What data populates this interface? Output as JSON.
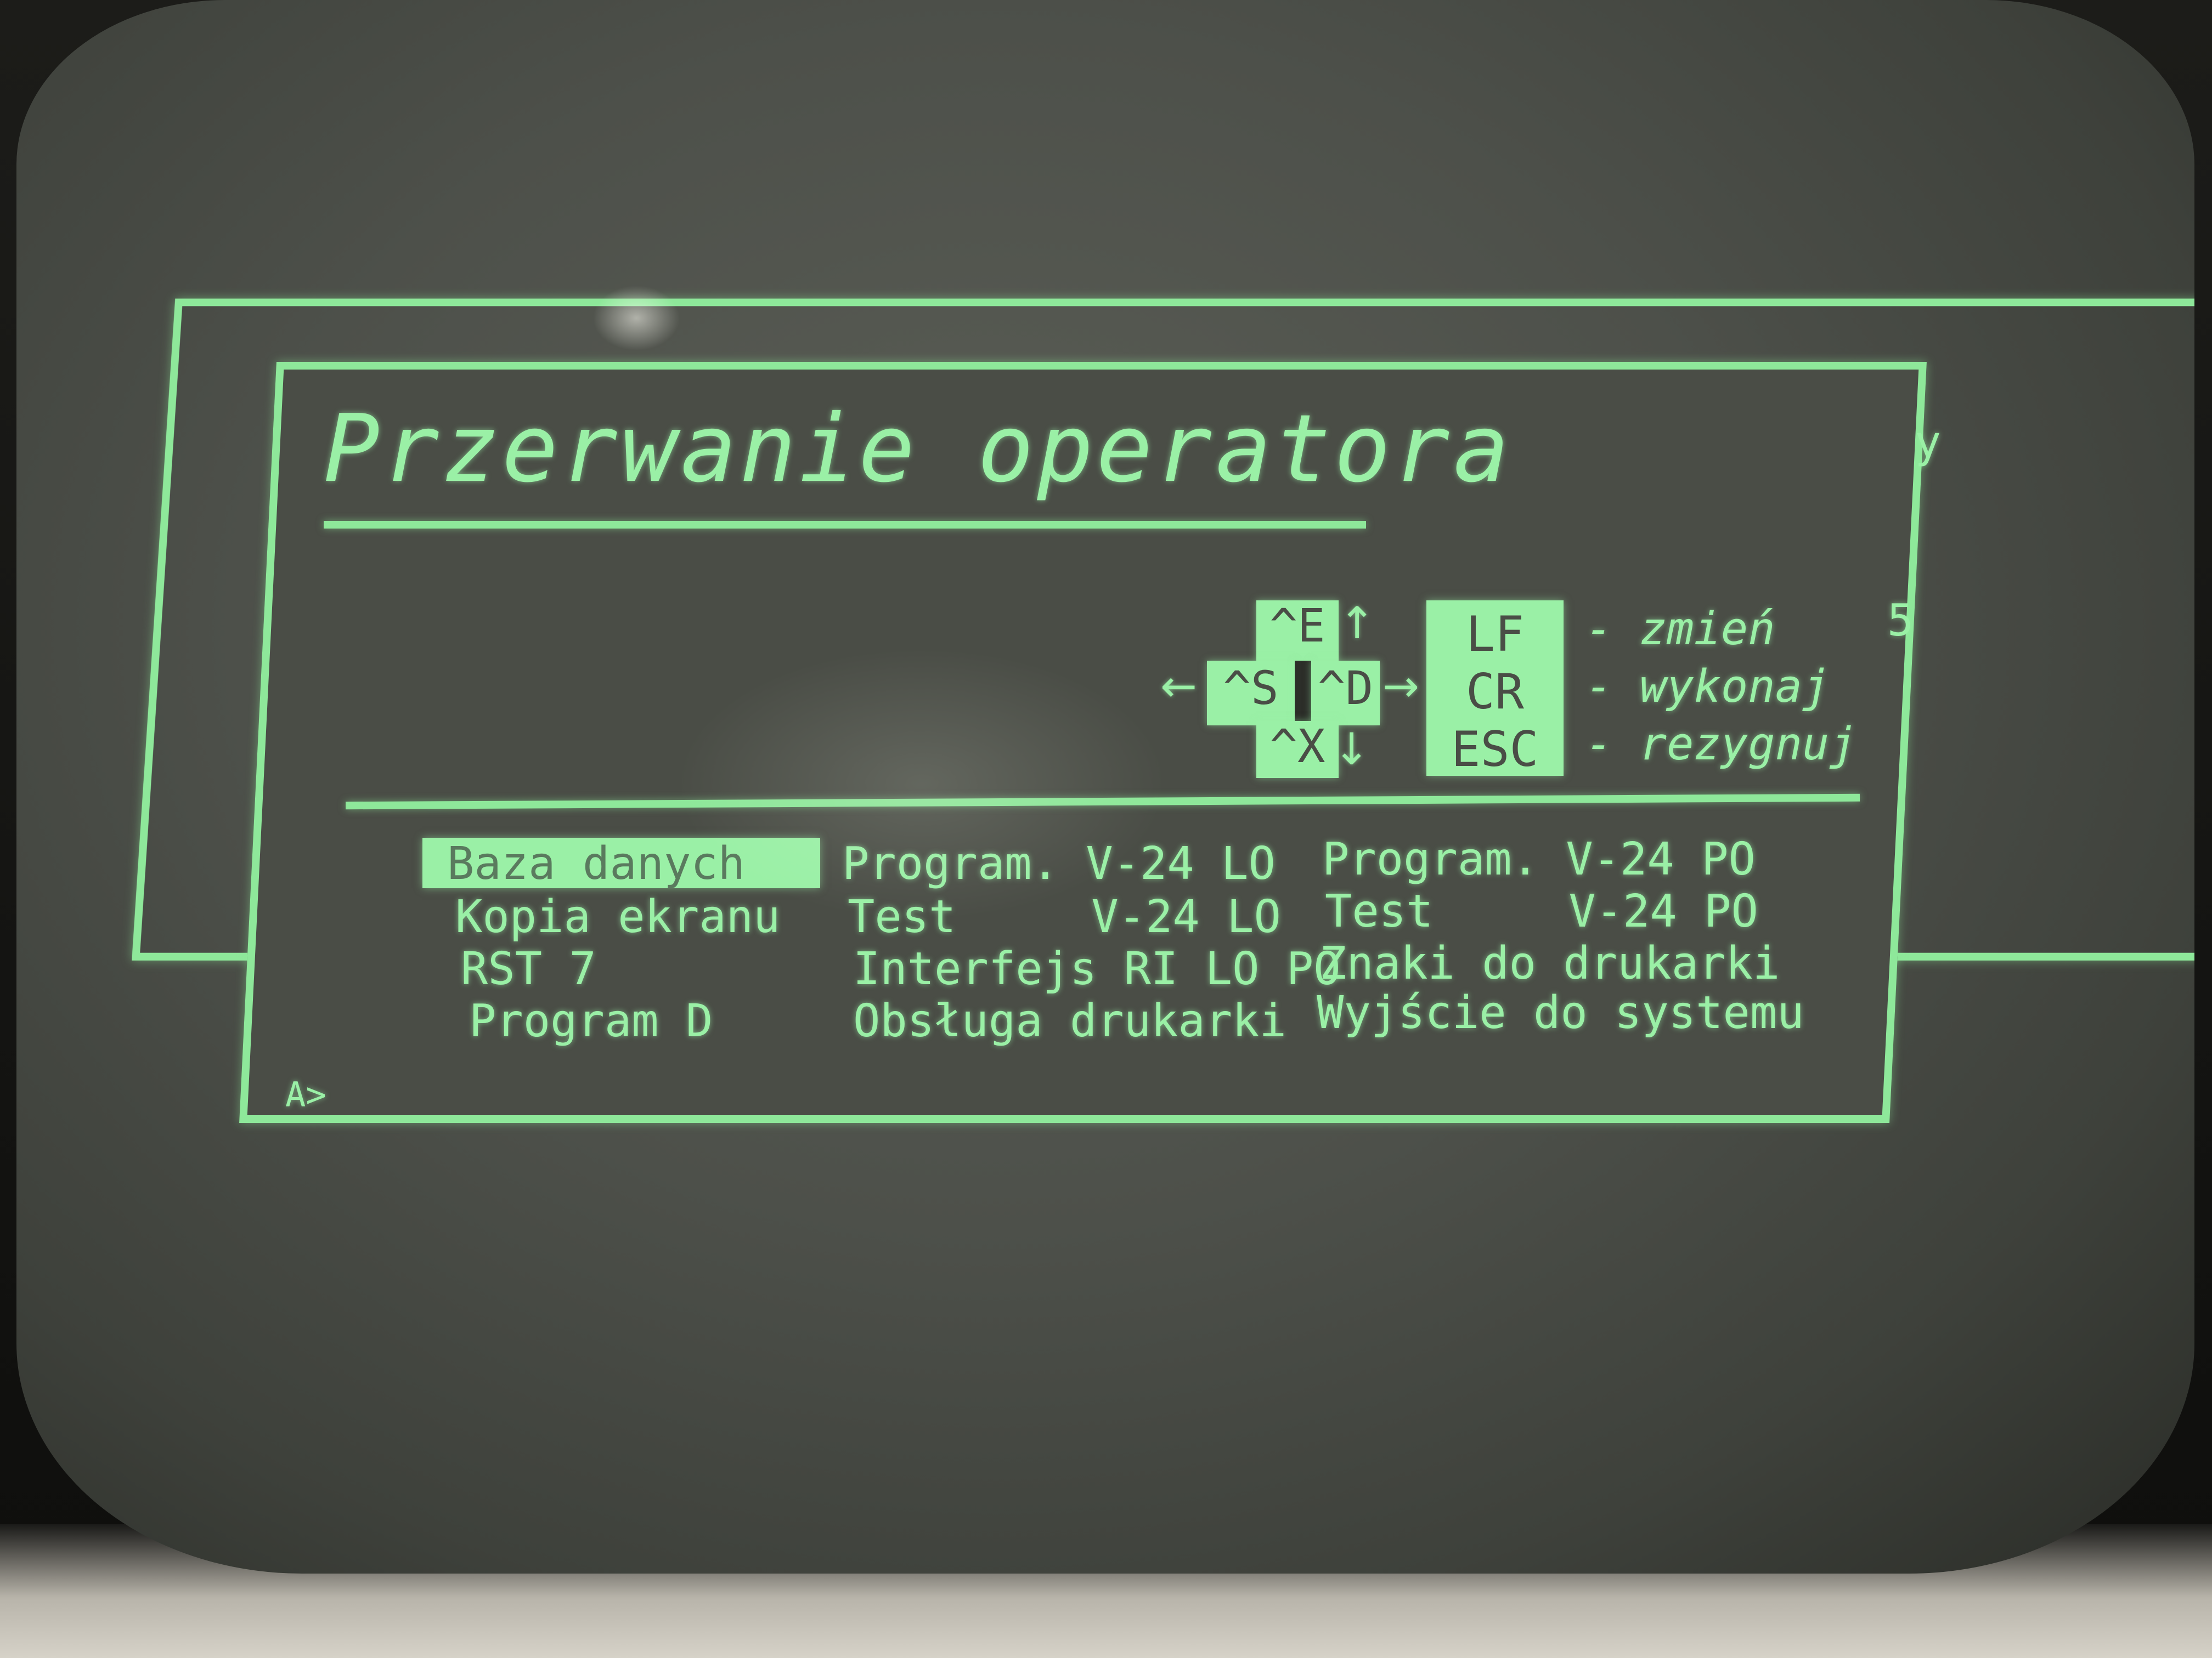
{
  "screen": {
    "title": "Przerwanie operatora",
    "prompt": "A>",
    "edge_chars": [
      "y",
      "5"
    ]
  },
  "keys": {
    "up": "^E",
    "left": "^S",
    "right": "^D",
    "down": "^X",
    "arrow_up": "↑",
    "arrow_left": "←",
    "arrow_right": "→",
    "arrow_down": "↓"
  },
  "commands": [
    {
      "key": "LF",
      "desc": "- zmień"
    },
    {
      "key": "CR",
      "desc": "- wykonaj"
    },
    {
      "key": "ESC",
      "desc": "- rezygnuj"
    }
  ],
  "menu": {
    "selected": "Baza danych",
    "col1": [
      "Baza danych",
      "Kopia ekranu",
      "RST 7",
      "Program D"
    ],
    "col2": [
      "Program. V-24 LO",
      "Test     V-24 LO",
      "Interfejs RI LO PO",
      "Obsługa drukarki"
    ],
    "col3": [
      "Program. V-24 PO",
      "Test     V-24 PO",
      "Znaki do drukarki",
      "Wyjście do systemu"
    ]
  },
  "colors": {
    "phosphor": "#9af0a6",
    "screen": "#4a4d46"
  }
}
